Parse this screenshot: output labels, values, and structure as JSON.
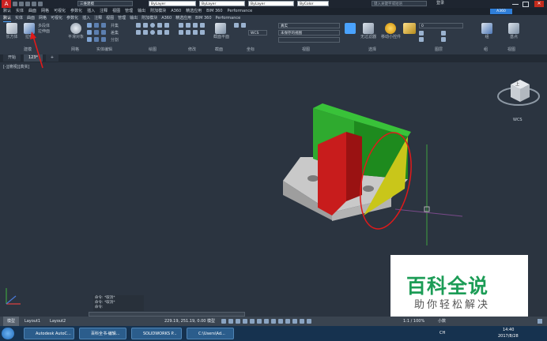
{
  "window": {
    "workspace": "三维建模",
    "title": "Autodesk AutoCAD 2016 Drawing1.dwg",
    "search_placeholder": "键入关键字或短语",
    "signin": "登录",
    "share_label": "A360"
  },
  "properties": {
    "color": "ByLayer",
    "linetype": "ByLayer",
    "lineweight": "ByLayer",
    "plotstyle": "ByColor"
  },
  "menu": [
    "默认",
    "实体",
    "曲面",
    "网格",
    "可视化",
    "参数化",
    "插入",
    "注释",
    "视图",
    "管理",
    "输出",
    "附加模块",
    "A360",
    "精选应用",
    "BIM 360",
    "Performance"
  ],
  "ribbon": {
    "tabs": [
      "默认",
      "实体",
      "曲面",
      "网格",
      "可视化",
      "参数化",
      "插入",
      "注释",
      "视图",
      "管理",
      "输出",
      "附加模块",
      "A360",
      "精选应用",
      "BIM 360",
      "Performance"
    ],
    "active_tab": "默认",
    "buttons": {
      "box": "长方体",
      "extrude": "拉伸",
      "smooth": "平滑对象",
      "section": "截面平面",
      "no_filter": "无过滤器",
      "gizmo": "移动小控件",
      "group": "组",
      "base": "基点"
    },
    "small_buttons": [
      "多段体",
      "拉伸面",
      "分割",
      "提取边",
      "并集",
      "差集",
      "交集",
      "剖切",
      "加厚"
    ],
    "view_combo": "未保存的视图",
    "visual_style": "真实",
    "layer_combo": "0",
    "panels": [
      "建模",
      "网格",
      "实体编辑",
      "绘图",
      "修改",
      "截面",
      "坐标",
      "视图",
      "选择",
      "图层",
      "组",
      "视图"
    ]
  },
  "tabs": {
    "start": "开始",
    "drawing": "123*",
    "add": "+"
  },
  "viewport": {
    "label": "[-][俯视][真实]",
    "wcs": "WCS",
    "viewcube_face": "上",
    "cmd_lines": [
      "命令: *取消*",
      "命令: *取消*",
      "命令:"
    ]
  },
  "layout_tabs": [
    "模型",
    "Layout1",
    "Layout2"
  ],
  "status": {
    "coords": "229.19, 251.19, 0.00",
    "mode": "模型",
    "scale": "1:1 / 100%",
    "units": "小数"
  },
  "taskbar": {
    "items": [
      "Autodesk AutoC...",
      "百科全书-编辑...",
      "SOLIDWORKS P...",
      "C:\\Users\\Ad..."
    ],
    "lang": "CH",
    "time": "14:40",
    "date": "2017/8/28"
  },
  "watermark": {
    "title": "百科全说",
    "subtitle": "助你轻松解决"
  },
  "colors": {
    "accent": "#1c9c56",
    "annotation": "#e01a1a",
    "green_face": "#2fae2f",
    "red_face": "#c81c1c",
    "yellow_face": "#c8c51a",
    "gray_base": "#bdbdbd"
  }
}
